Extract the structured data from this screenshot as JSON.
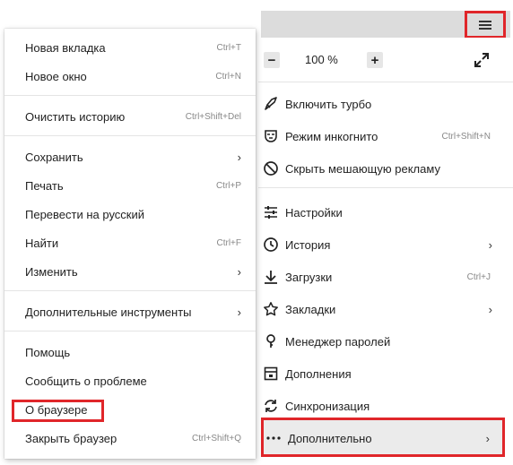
{
  "main_menu": {
    "zoom": {
      "minus": "−",
      "value": "100 %",
      "plus": "+"
    },
    "items": [
      {
        "label": "Включить турбо",
        "shortcut": "",
        "icon": "rocket-icon"
      },
      {
        "label": "Режим инкогнито",
        "shortcut": "Ctrl+Shift+N",
        "icon": "incognito-mask-icon"
      },
      {
        "label": "Скрыть мешающую рекламу",
        "shortcut": "",
        "icon": "block-ad-icon"
      },
      {
        "label": "Настройки",
        "shortcut": "",
        "icon": "settings-sliders-icon"
      },
      {
        "label": "История",
        "shortcut": "",
        "arrow": "›",
        "icon": "history-icon"
      },
      {
        "label": "Загрузки",
        "shortcut": "Ctrl+J",
        "icon": "download-icon"
      },
      {
        "label": "Закладки",
        "shortcut": "",
        "arrow": "›",
        "icon": "star-icon"
      },
      {
        "label": "Менеджер паролей",
        "shortcut": "",
        "icon": "key-icon"
      },
      {
        "label": "Дополнения",
        "shortcut": "",
        "icon": "extensions-icon"
      },
      {
        "label": "Синхронизация",
        "shortcut": "",
        "icon": "sync-icon"
      },
      {
        "label": "Дополнительно",
        "shortcut": "",
        "arrow": "›",
        "icon": "more-dots-icon"
      }
    ]
  },
  "context_menu": {
    "items": [
      {
        "label": "Новая вкладка",
        "shortcut": "Ctrl+T"
      },
      {
        "label": "Новое окно",
        "shortcut": "Ctrl+N"
      },
      {
        "label": "Очистить историю",
        "shortcut": "Ctrl+Shift+Del"
      },
      {
        "label": "Сохранить",
        "arrow": "›"
      },
      {
        "label": "Печать",
        "shortcut": "Ctrl+P"
      },
      {
        "label": "Перевести на русский"
      },
      {
        "label": "Найти",
        "shortcut": "Ctrl+F"
      },
      {
        "label": "Изменить",
        "arrow": "›"
      },
      {
        "label": "Дополнительные инструменты",
        "arrow": "›"
      },
      {
        "label": "Помощь"
      },
      {
        "label": "Сообщить о проблеме"
      },
      {
        "label": "О браузере"
      },
      {
        "label": "Закрыть браузер",
        "shortcut": "Ctrl+Shift+Q"
      }
    ]
  },
  "colors": {
    "highlight_border": "#e0262a",
    "topbar": "#dcdcdc"
  }
}
